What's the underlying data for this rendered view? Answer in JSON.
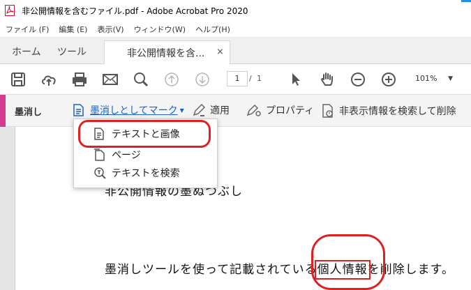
{
  "titlebar": {
    "title": "非公開情報を含むファイル.pdf - Adobe Acrobat Pro 2020"
  },
  "menubar": {
    "items": [
      "ファイル (F)",
      "編集 (E)",
      "表示(V)",
      "ウィンドウ(W)",
      "ヘルプ(H)"
    ]
  },
  "tabs": {
    "home": "ホーム",
    "tools": "ツール",
    "document": "非公開情報を含...",
    "close": "×"
  },
  "toolbar": {
    "page_current": "1",
    "page_sep": "/",
    "page_total": "1",
    "zoom": "101%"
  },
  "redact_bar": {
    "tool_name": "墨消し",
    "mark_label": "墨消しとしてマーク",
    "apply_label": "適用",
    "properties_label": "プロパティ",
    "search_remove_label": "非表示情報を検索して削除"
  },
  "dropdown": {
    "items": [
      "テキストと画像",
      "ページ",
      "テキストを検索"
    ]
  },
  "document": {
    "heading": "非公開情報の墨ぬつぶし",
    "line_before": "墨消しツールを使って記載されている",
    "line_target": "個人情報",
    "line_after": "を削除します。"
  },
  "colors": {
    "accent_pink": "#d43c91",
    "link_blue": "#1a62c7",
    "annotation_red": "#e02020"
  }
}
